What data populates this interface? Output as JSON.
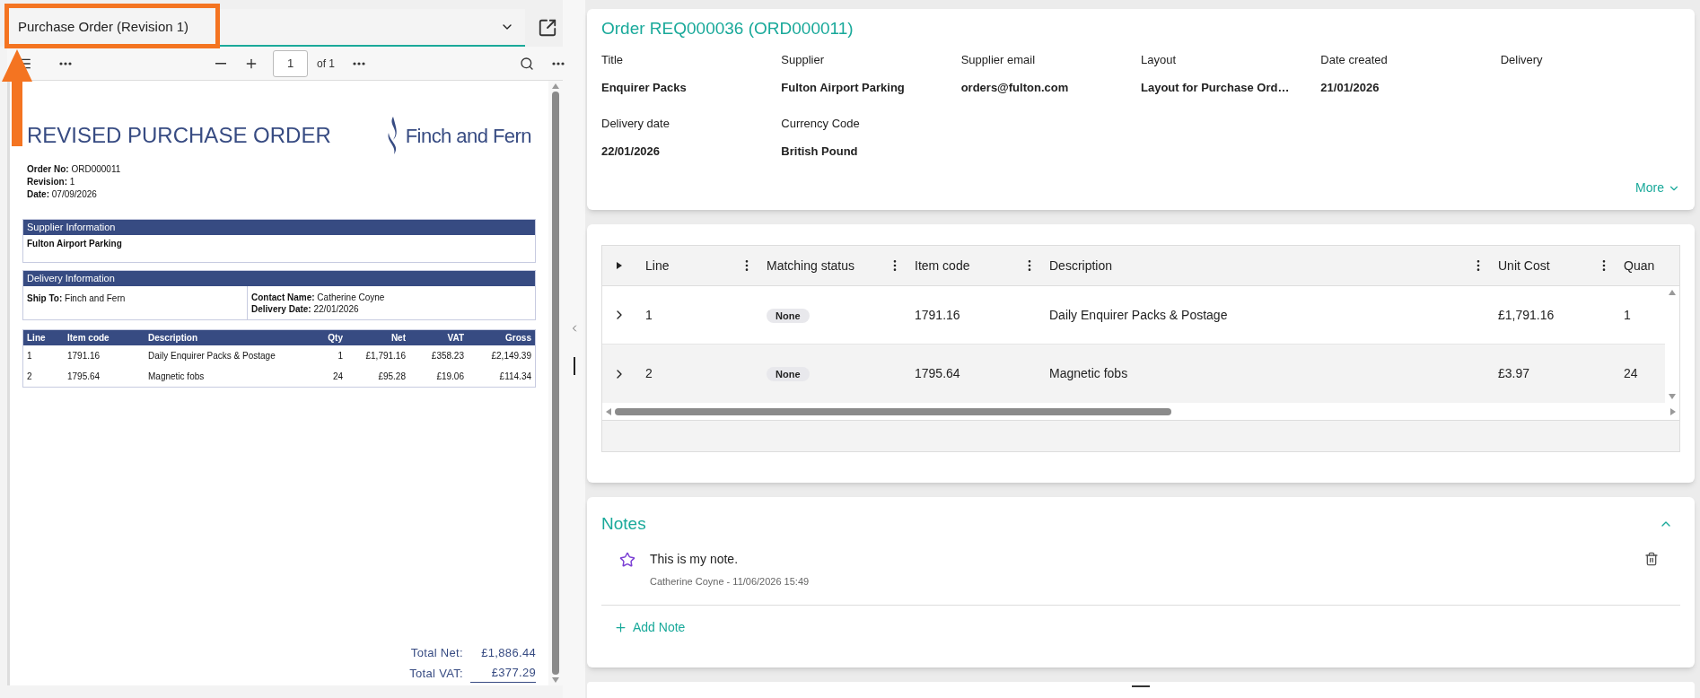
{
  "document_selector": {
    "value": "Purchase Order (Revision 1)"
  },
  "viewer_toolbar": {
    "page": "1",
    "page_count": "of 1"
  },
  "document": {
    "title": "REVISED PURCHASE ORDER",
    "logo_text": "Finch and Fern",
    "meta": [
      {
        "label": "Order No:",
        "value": "ORD000011"
      },
      {
        "label": "Revision:",
        "value": "1"
      },
      {
        "label": "Date:",
        "value": "07/09/2026"
      }
    ],
    "supplier": {
      "heading": "Supplier Information",
      "name": "Fulton Airport Parking"
    },
    "delivery": {
      "heading": "Delivery Information",
      "ship_to_label": "Ship To:",
      "ship_to": "Finch and Fern",
      "contact_label": "Contact Name:",
      "contact": "Catherine Coyne",
      "date_label": "Delivery Date:",
      "date": "22/01/2026"
    },
    "lines": {
      "columns": [
        "Line",
        "Item code",
        "Description",
        "Qty",
        "Net",
        "VAT",
        "Gross"
      ],
      "rows": [
        [
          "1",
          "1791.16",
          "Daily Enquirer Packs & Postage",
          "1",
          "£1,791.16",
          "£358.23",
          "£2,149.39"
        ],
        [
          "2",
          "1795.64",
          "Magnetic fobs",
          "24",
          "£95.28",
          "£19.06",
          "£114.34"
        ]
      ]
    },
    "totals": [
      {
        "label": "Total Net:",
        "value": "£1,886.44",
        "underlined": false
      },
      {
        "label": "Total VAT:",
        "value": "£377.29",
        "underlined": true
      }
    ]
  },
  "order": {
    "title": "Order REQ000036 (ORD000011)",
    "fields": [
      {
        "label": "Title",
        "value": "Enquirer Packs"
      },
      {
        "label": "Supplier",
        "value": "Fulton Airport Parking"
      },
      {
        "label": "Supplier email",
        "value": "orders@fulton.com"
      },
      {
        "label": "Layout",
        "value": "Layout for Purchase Ord…"
      },
      {
        "label": "Date created",
        "value": "21/01/2026"
      },
      {
        "label": "Delivery"
      },
      {
        "label": "Delivery date",
        "value": "22/01/2026"
      },
      {
        "label": "Currency Code",
        "value": "British Pound"
      }
    ],
    "more": "More"
  },
  "lines_table": {
    "columns": [
      "Line",
      "Matching status",
      "Item code",
      "Description",
      "Unit Cost",
      "Quan"
    ],
    "rows": [
      {
        "expanded": false,
        "line": "1",
        "status": "None",
        "item_code": "1791.16",
        "description": "Daily Enquirer Packs & Postage",
        "unit_cost": "£1,791.16",
        "quantity": "1"
      },
      {
        "expanded": false,
        "line": "2",
        "status": "None",
        "item_code": "1795.64",
        "description": "Magnetic fobs",
        "unit_cost": "£3.97",
        "quantity": "24"
      }
    ]
  },
  "notes": {
    "title": "Notes",
    "expanded": true,
    "items": [
      {
        "text": "This is my note.",
        "meta": "Catherine Coyne - 11/06/2026 15:49",
        "starred": false
      }
    ],
    "add": "Add Note"
  }
}
